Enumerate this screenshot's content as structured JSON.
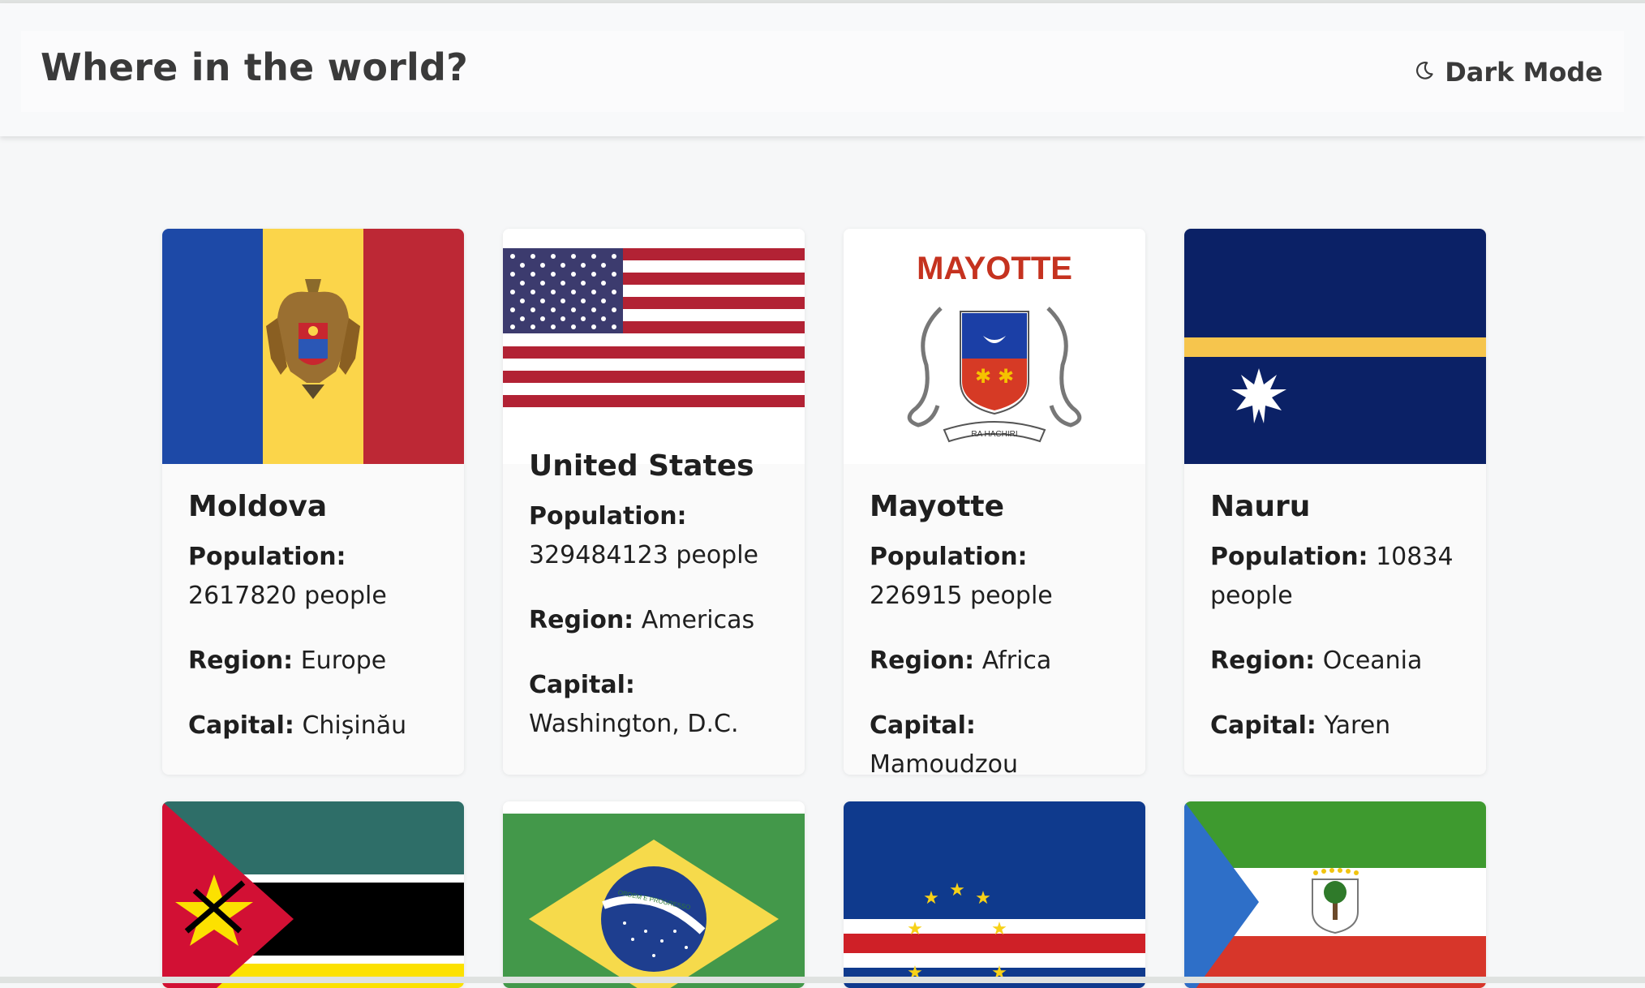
{
  "header": {
    "title": "Where in the world?",
    "mode_label": "Dark Mode"
  },
  "labels": {
    "population": "Population:",
    "region": "Region:",
    "capital": "Capital:"
  },
  "countries": [
    {
      "name": "Moldova",
      "population": "2617820 people",
      "region": "Europe",
      "capital": "Chișinău"
    },
    {
      "name": "United States",
      "population": "329484123 people",
      "region": "Americas",
      "capital": "Washington, D.C."
    },
    {
      "name": "Mayotte",
      "population": "226915 people",
      "region": "Africa",
      "capital": "Mamoudzou"
    },
    {
      "name": "Nauru",
      "population": "10834 people",
      "region": "Oceania",
      "capital": "Yaren"
    }
  ],
  "flag_text": {
    "mayotte_title": "MAYOTTE",
    "mayotte_motto": "RA HACHIRI",
    "brazil_motto": "ORDEM E PROGRESSO"
  },
  "colors": {
    "page_bg": "#f6f7f8",
    "card_bg": "#fafafa",
    "text": "#1f1f1f"
  }
}
